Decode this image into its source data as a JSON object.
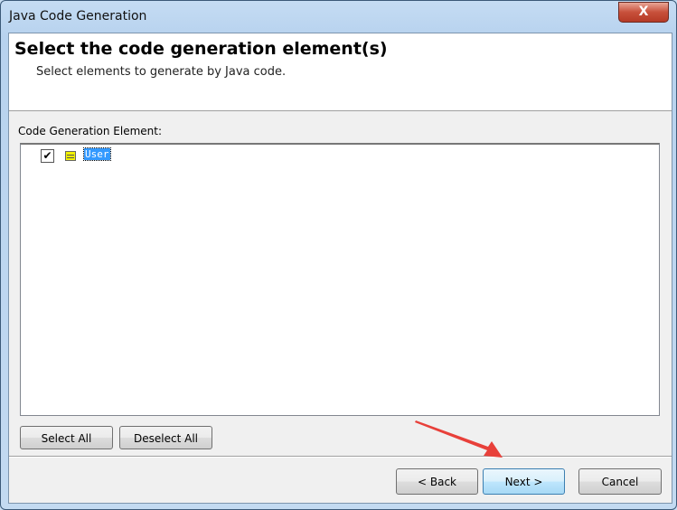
{
  "window": {
    "title": "Java Code Generation",
    "close_label": "X"
  },
  "header": {
    "title": "Select the code generation element(s)",
    "subtitle": "Select elements to generate by Java code."
  },
  "tree": {
    "label": "Code Generation Element:",
    "items": [
      {
        "label": "User",
        "checked": true,
        "selected": true,
        "icon": "class-icon"
      }
    ]
  },
  "buttons": {
    "select_all": "Select All",
    "deselect_all": "Deselect All",
    "back": "< Back",
    "next": "Next >",
    "cancel": "Cancel"
  },
  "annotation": {
    "arrow_color": "#e8403a",
    "points_to": "next-button"
  }
}
